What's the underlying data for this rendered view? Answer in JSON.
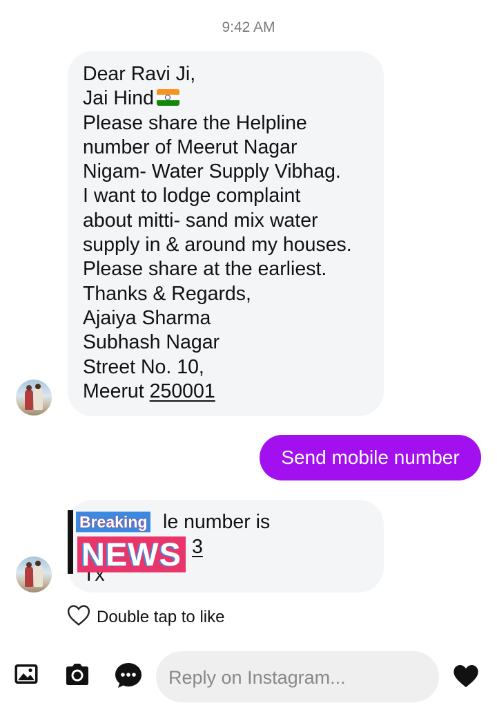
{
  "thread": {
    "timestamp": "9:42 AM",
    "message1": {
      "lines": [
        "Dear Ravi Ji,",
        "Jai Hind",
        "Please share the Helpline",
        "number of Meerut Nagar",
        "Nigam- Water Supply Vibhag.",
        "I want to lodge complaint",
        "about mitti- sand mix water",
        "supply in & around my houses.",
        "Please share at the earliest.",
        "Thanks & Regards,",
        "Ajaiya Sharma",
        "Subhash Nagar",
        "Street No. 10,",
        "Meerut"
      ],
      "pincode": "250001",
      "flag_icon": "india-flag-emoji"
    },
    "message2_sent": "Send mobile number",
    "message3": {
      "line1_visible": "le number is",
      "line2_visible": "3",
      "line3_visible": "Tx"
    },
    "overlay": {
      "breaking": "Breaking",
      "news": "NEWS"
    },
    "like_hint": "Double tap to like"
  },
  "composer": {
    "placeholder": "Reply on Instagram...",
    "icons": [
      "gallery-icon",
      "camera-icon",
      "sticker-icon",
      "heart-icon"
    ]
  },
  "colors": {
    "sent_bubble": "#a210f0",
    "received_bubble": "#f4f5f7",
    "breaking_bg": "#3c89e0",
    "news_bg": "#e8366b"
  }
}
